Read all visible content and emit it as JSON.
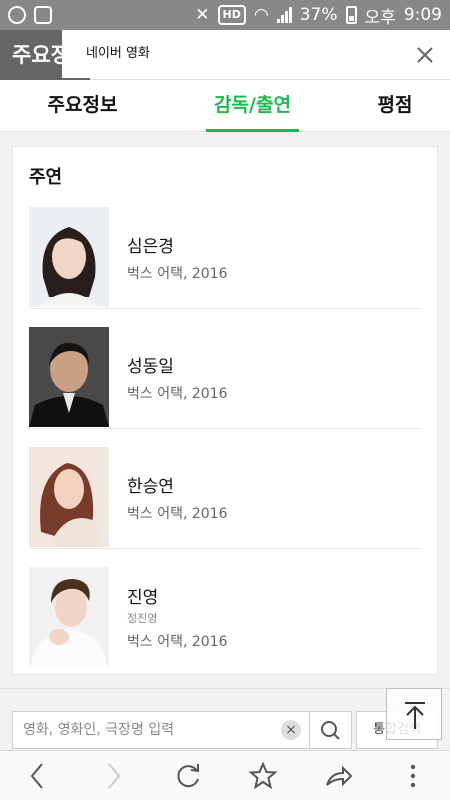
{
  "status_bar": {
    "battery_text": "37%",
    "carrier_text": "오후",
    "time": "9:09",
    "hd_badge": "HD"
  },
  "header": {
    "back_title": "주요정",
    "popup_title": "네이버 영화",
    "close_icon": "close-icon"
  },
  "tabs": [
    {
      "label": "주요정보",
      "active": false
    },
    {
      "label": "감독/출연",
      "active": true
    },
    {
      "label": "평점",
      "active": false
    }
  ],
  "accent_color": "#1fb84f",
  "cast_section": {
    "title": "주연",
    "members": [
      {
        "name": "심은경",
        "real_name": "",
        "work": "벅스 어택, 2016"
      },
      {
        "name": "성동일",
        "real_name": "",
        "work": "벅스 어택, 2016"
      },
      {
        "name": "한승연",
        "real_name": "",
        "work": "벅스 어택, 2016"
      },
      {
        "name": "진영",
        "real_name": "정진영",
        "work": "벅스 어택, 2016"
      }
    ]
  },
  "search": {
    "placeholder": "영화, 영화인, 극장명 입력",
    "integrated_label": "통합검색"
  },
  "browser_nav": {
    "icons": [
      "back-icon",
      "forward-icon",
      "refresh-icon",
      "bookmark-star-icon",
      "share-icon",
      "more-icon"
    ]
  }
}
